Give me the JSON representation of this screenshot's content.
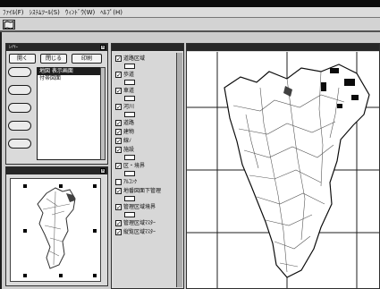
{
  "app": {
    "title": "",
    "menu": [
      "ﾌｧｲﾙ(F)",
      "ｼｽﾃﾑﾂｰﾙ(S)",
      "ｳｨﾝﾄﾞｳ(W)",
      "ﾍﾙﾌﾟ(H)"
    ]
  },
  "layer_panel": {
    "title": "ﾚｲﾔｰ",
    "top_buttons": [
      "開く",
      "閉じる",
      "印刷"
    ],
    "side_buttons": [
      "",
      "",
      "",
      "",
      ""
    ],
    "items": [
      "地図 表示画面",
      "付帯図面"
    ]
  },
  "overview_panel": {
    "title": ""
  },
  "legend_panel": {
    "title": "",
    "items": [
      {
        "label": "道路区域",
        "checked": true,
        "swatch": true
      },
      {
        "label": "歩道",
        "checked": true,
        "swatch": true
      },
      {
        "label": "車道",
        "checked": true,
        "swatch": true
      },
      {
        "label": "河川",
        "checked": true,
        "swatch": true
      },
      {
        "label": "道路",
        "checked": true,
        "swatch": false
      },
      {
        "label": "建物",
        "checked": true,
        "swatch": false
      },
      {
        "label": "線ﾉ",
        "checked": true,
        "swatch": false
      },
      {
        "label": "施設",
        "checked": true,
        "swatch": true
      },
      {
        "label": "区・境界",
        "checked": true,
        "swatch": true
      },
      {
        "label": "ｱﾙｺﾝｸ",
        "checked": false,
        "swatch": false
      },
      {
        "label": "地番図面下管理",
        "checked": true,
        "swatch": true
      },
      {
        "label": "管理区域境界",
        "checked": true,
        "swatch": true
      },
      {
        "label": "管理区域ﾏｽﾀｰ",
        "checked": true,
        "swatch": false
      },
      {
        "label": "縦覧区域ﾏｽﾀｰ",
        "checked": true,
        "swatch": false
      }
    ]
  },
  "map_panel": {
    "title": ""
  }
}
